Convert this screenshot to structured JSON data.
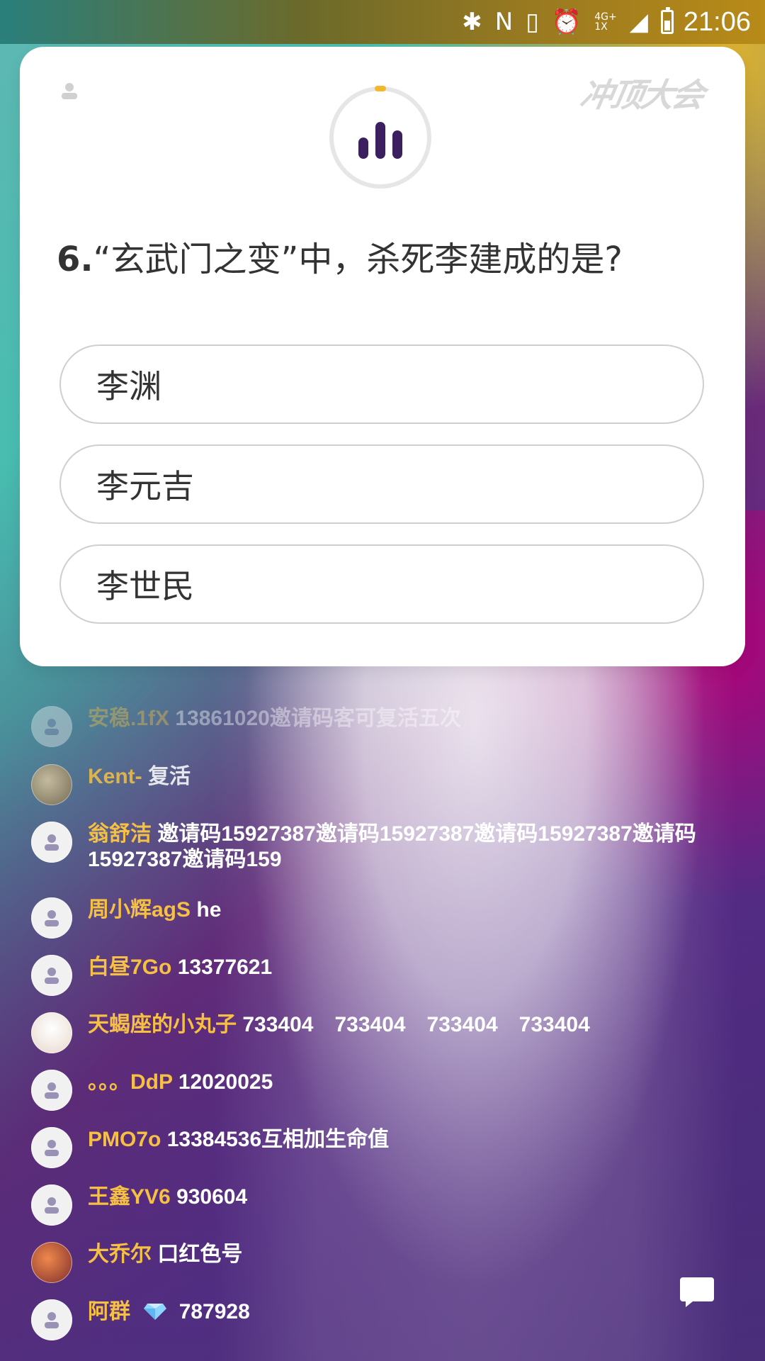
{
  "status_bar": {
    "time": "21:06",
    "network_top": "4G+",
    "network_bottom": "1X"
  },
  "card": {
    "brand_logo": "冲顶大会",
    "question_number": "6.",
    "question_text": "“玄武门之变”中，杀死李建成的是?",
    "options": [
      {
        "label": "李渊"
      },
      {
        "label": "李元吉"
      },
      {
        "label": "李世民"
      }
    ]
  },
  "chat": [
    {
      "name": "安稳.1fX",
      "content": "13861020邀请码客可复活五次"
    },
    {
      "name": "Kent-",
      "content": "复活"
    },
    {
      "name": "翁舒洁",
      "content": "邀请码15927387邀请码15927387邀请码15927387邀请码15927387邀请码159"
    },
    {
      "name": "周小辉agS",
      "content": "he"
    },
    {
      "name": "白昼7Go",
      "content": "13377621"
    },
    {
      "name": "天蝎座的小丸子",
      "content": "733404　733404　733404　733404"
    },
    {
      "name": "。。。DdP",
      "content": "12020025"
    },
    {
      "name": "PMO7o",
      "content": "13384536互相加生命值"
    },
    {
      "name": "王鑫YV6",
      "content": "930604"
    },
    {
      "name": "大乔尔",
      "content": "口红色号"
    },
    {
      "name": "阿群",
      "content": "787928"
    }
  ]
}
